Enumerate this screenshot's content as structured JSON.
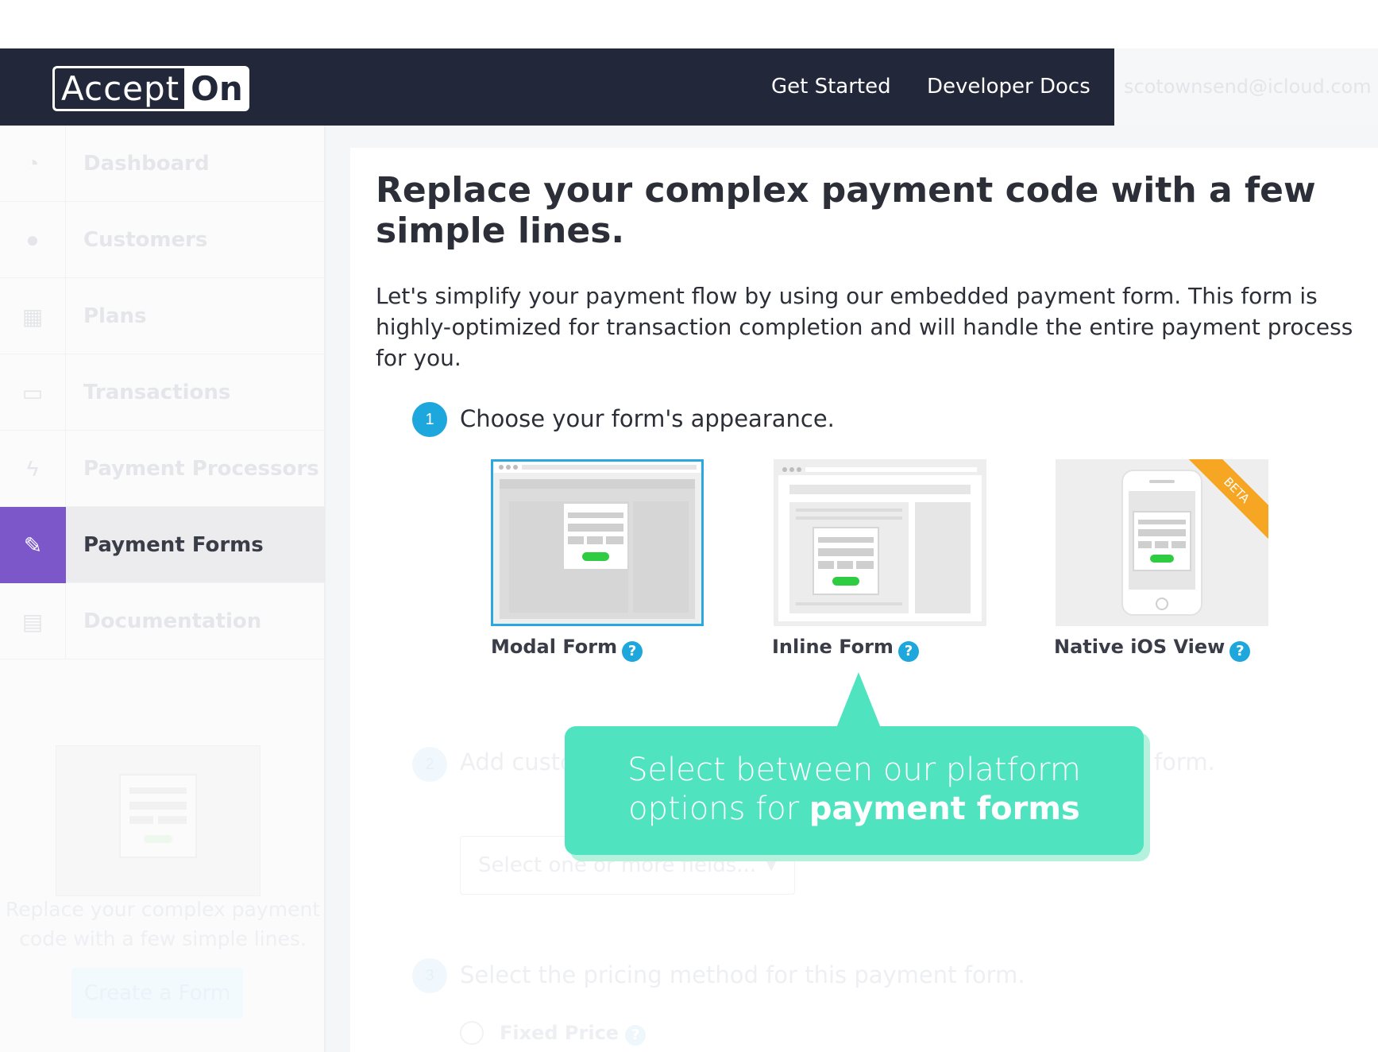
{
  "header": {
    "logo_main": "Accept",
    "logo_on": "On",
    "nav": {
      "get_started": "Get Started",
      "developer_docs": "Developer Docs"
    },
    "user_email": "scotownsend@icloud.com"
  },
  "sidebar": {
    "items": [
      {
        "label": "Dashboard",
        "icon": "dashboard-icon",
        "glyph": "◔"
      },
      {
        "label": "Customers",
        "icon": "user-icon",
        "glyph": "●"
      },
      {
        "label": "Plans",
        "icon": "calendar-icon",
        "glyph": "▦"
      },
      {
        "label": "Transactions",
        "icon": "money-icon",
        "glyph": "▭"
      },
      {
        "label": "Payment Processors",
        "icon": "bolt-icon",
        "glyph": "ϟ"
      },
      {
        "label": "Payment Forms",
        "icon": "edit-icon",
        "glyph": "✎",
        "active": true
      },
      {
        "label": "Documentation",
        "icon": "document-icon",
        "glyph": "▤"
      }
    ],
    "promo": {
      "text": "Replace your complex payment code with a few simple lines.",
      "button": "Create a Form"
    },
    "accent_color": "#7c57c9"
  },
  "main": {
    "title": "Replace your complex payment code with a few simple lines.",
    "description": "Let's simplify your payment flow by using our embedded payment form. This form is highly-optimized for transaction completion and will handle the entire payment process for you.",
    "step1": {
      "number": "1",
      "text": "Choose your form's appearance."
    },
    "options": [
      {
        "label": "Modal Form",
        "selected": true
      },
      {
        "label": "Inline Form"
      },
      {
        "label": "Native iOS View",
        "badge": "BETA"
      }
    ],
    "help_glyph": "?",
    "step2": {
      "number": "2",
      "text": "Add custom fields you want displayed and required on your form.",
      "select_placeholder": "Select one or more fields..."
    },
    "step3": {
      "number": "3",
      "text": "Select the pricing method for this payment form."
    },
    "fixed_price_label": "Fixed Price"
  },
  "callout": {
    "line1": "Select between our platform",
    "line2_prefix": "options for",
    "line2_bold": "payment forms"
  },
  "colors": {
    "header_bg": "#222739",
    "accent_blue": "#1da7dd",
    "callout": "#50e3c0",
    "button_green": "#2ecc40",
    "beta_orange": "#f6a623"
  }
}
